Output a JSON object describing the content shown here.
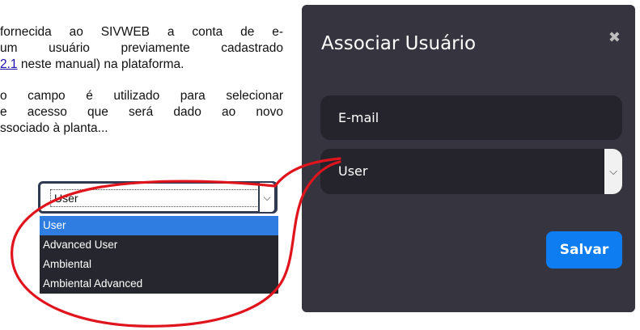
{
  "document": {
    "para1": {
      "line1": "fornecida ao SIVWEB a conta de e-",
      "line2": "um usuário previamente cadastrado",
      "line3_link": "2.1",
      "line3_rest": " neste manual) na plataforma."
    },
    "para2": {
      "line1": "o campo é utilizado para selecionar",
      "line2": "e acesso que será dado ao novo",
      "line3": "ssociado à planta..."
    }
  },
  "inline_dropdown": {
    "selected": "User",
    "options": [
      "User",
      "Advanced User",
      "Ambiental",
      "Ambiental Advanced"
    ],
    "highlight_color": "#2f7de1"
  },
  "modal": {
    "title": "Associar Usuário",
    "close_glyph": "✖",
    "email_placeholder": "E-mail",
    "role_value": "User",
    "save_label": "Salvar",
    "colors": {
      "background": "#36353f",
      "field": "#25242c",
      "button": "#0f7df2",
      "annotation": "#e0141c"
    }
  }
}
